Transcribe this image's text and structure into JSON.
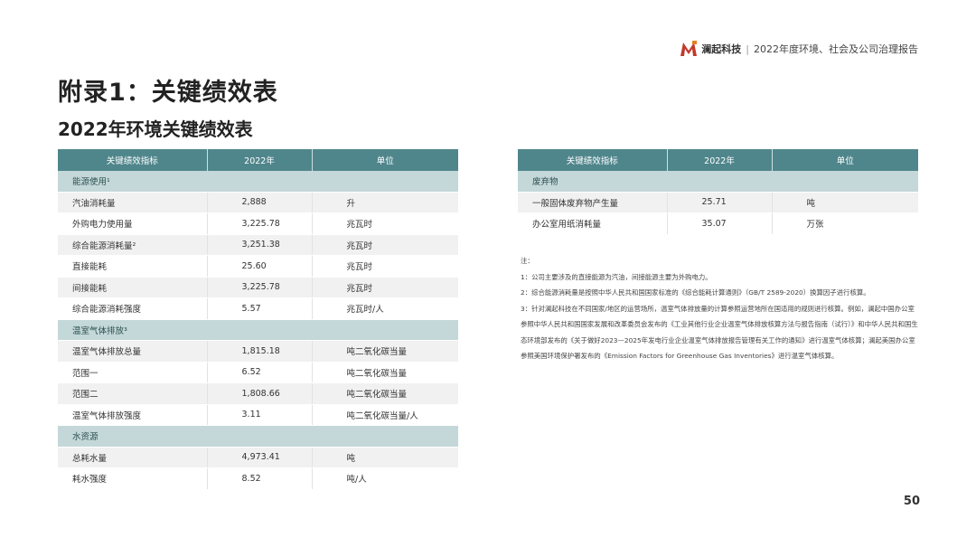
{
  "header": {
    "company": "澜起科技",
    "report_title": "2022年度环境、社会及公司治理报告",
    "logo_color": "#c0392b"
  },
  "title": "附录1：关键绩效表",
  "subtitle": "2022年环境关键绩效表",
  "table_left": {
    "headers": [
      "关键绩效指标",
      "2022年",
      "单位"
    ],
    "rows": [
      {
        "type": "section",
        "label": "能源使用¹"
      },
      {
        "type": "data",
        "cells": [
          "汽油消耗量",
          "2,888",
          "升"
        ]
      },
      {
        "type": "data",
        "cells": [
          "外购电力使用量",
          "3,225.78",
          "兆瓦时"
        ]
      },
      {
        "type": "data",
        "cells": [
          "综合能源消耗量²",
          "3,251.38",
          "兆瓦时"
        ]
      },
      {
        "type": "data",
        "cells": [
          "直接能耗",
          "25.60",
          "兆瓦时"
        ]
      },
      {
        "type": "data",
        "cells": [
          "间接能耗",
          "3,225.78",
          "兆瓦时"
        ]
      },
      {
        "type": "data",
        "cells": [
          "综合能源消耗强度",
          "5.57",
          "兆瓦时/人"
        ]
      },
      {
        "type": "section",
        "label": "温室气体排放³"
      },
      {
        "type": "data",
        "cells": [
          "温室气体排放总量",
          "1,815.18",
          "吨二氧化碳当量"
        ]
      },
      {
        "type": "data",
        "cells": [
          "范围一",
          "6.52",
          "吨二氧化碳当量"
        ]
      },
      {
        "type": "data",
        "cells": [
          "范围二",
          "1,808.66",
          "吨二氧化碳当量"
        ]
      },
      {
        "type": "data",
        "cells": [
          "温室气体排放强度",
          "3.11",
          "吨二氧化碳当量/人"
        ]
      },
      {
        "type": "section",
        "label": "水资源"
      },
      {
        "type": "data",
        "cells": [
          "总耗水量",
          "4,973.41",
          "吨"
        ]
      },
      {
        "type": "data",
        "cells": [
          "耗水强度",
          "8.52",
          "吨/人"
        ]
      }
    ]
  },
  "table_right": {
    "headers": [
      "关键绩效指标",
      "2022年",
      "单位"
    ],
    "rows": [
      {
        "type": "section",
        "label": "废弃物"
      },
      {
        "type": "data",
        "cells": [
          "一般固体废弃物产生量",
          "25.71",
          "吨"
        ]
      },
      {
        "type": "data",
        "cells": [
          "办公室用纸消耗量",
          "35.07",
          "万张"
        ]
      }
    ]
  },
  "notes": {
    "heading": "注：",
    "items": [
      "1：公司主要涉及的直接能源为汽油，间接能源主要为外购电力。",
      "2：综合能源消耗量是按照中华人民共和国国家标准的《综合能耗计算通则》（GB/T 2589-2020）换算因子进行核算。",
      "3：针对澜起科技在不同国家/地区的运营场所，温室气体排放量的计算参照运营地所在国适用的规则进行核算。例如，澜起中国办公室参照中华人民共和国国家发展和改革委员会发布的《工业其他行业企业温室气体排放核算方法与报告指南（试行）》和中华人民共和国生态环境部发布的《关于做好2023—2025年发电行业企业温室气体排放报告管理有关工作的通知》进行温室气体核算；澜起美国办公室参照美国环境保护署发布的《Emission Factors for Greenhouse Gas Inventories》进行温室气体核算。"
    ]
  },
  "page_number": "50"
}
